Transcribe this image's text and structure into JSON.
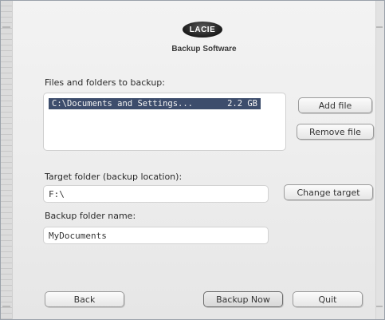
{
  "brand": {
    "logo_text": "LACIE",
    "subtitle": "Backup Software"
  },
  "sources": {
    "label": "Files and folders to backup:",
    "items": [
      {
        "path": "C:\\Documents and Settings...",
        "size": "2.2 GB",
        "selected": true
      }
    ],
    "add_label": "Add file",
    "remove_label": "Remove file"
  },
  "target": {
    "label": "Target folder (backup location):",
    "value": "F:\\",
    "change_label": "Change target"
  },
  "folder_name": {
    "label": "Backup folder name:",
    "value": "MyDocuments"
  },
  "footer": {
    "back_label": "Back",
    "backup_now_label": "Backup Now",
    "quit_label": "Quit"
  },
  "colors": {
    "selection": "#3d4d6c",
    "background": "#ececec",
    "frame": "#7e8896"
  }
}
